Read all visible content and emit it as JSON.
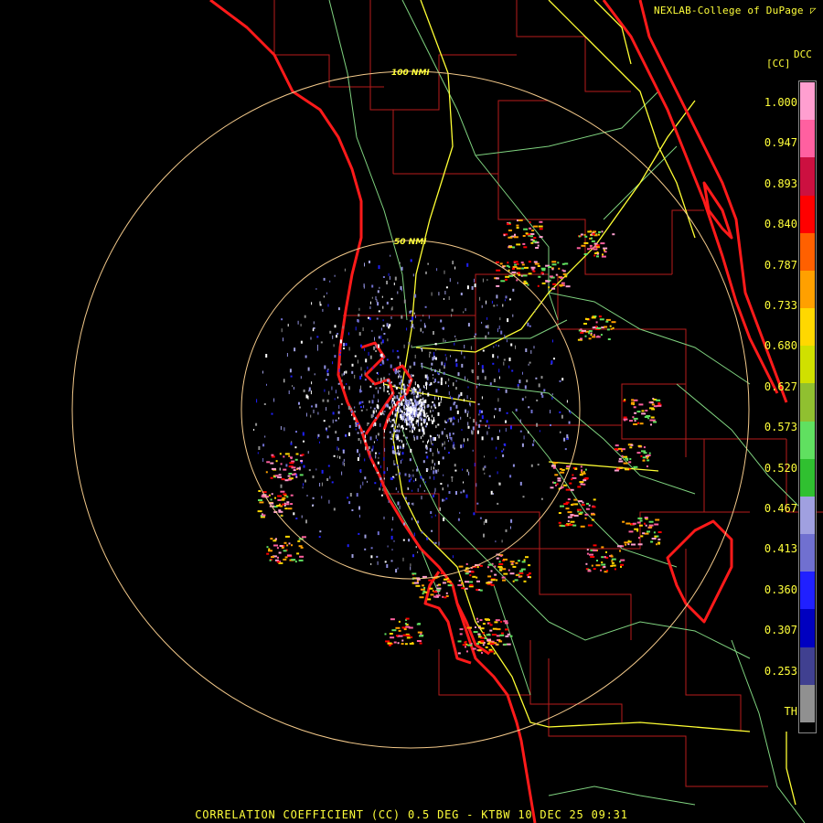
{
  "credit": "NEXLAB-College of DuPage",
  "credit_mark": "◸",
  "legend": {
    "product": "DCC",
    "unit": "[CC]",
    "ticks": [
      "1.000",
      "0.947",
      "0.893",
      "0.840",
      "0.787",
      "0.733",
      "0.680",
      "0.627",
      "0.573",
      "0.520",
      "0.467",
      "0.413",
      "0.360",
      "0.307",
      "0.253",
      "TH"
    ]
  },
  "range_rings": {
    "inner_label": "50 NMI",
    "outer_label": "100 NMI",
    "color": "#f3c98a"
  },
  "caption": "CORRELATION COEFFICIENT (CC) 0.5 DEG - KTBW 10 DEC 25 09:31",
  "colors": {
    "coastline": "#ff1a1a",
    "county_lines": "#b71c1c",
    "highways": "#ffff33",
    "roads": "#7fd27f",
    "text": "#ffff3a"
  },
  "scale_colors": [
    "#ff9fd0",
    "#ff60a0",
    "#cc1040",
    "#ff0000",
    "#ff6000",
    "#ffa000",
    "#ffd800",
    "#d0e000",
    "#90c030",
    "#60e060",
    "#30c030",
    "#a0a0e0",
    "#7070d0",
    "#2020ff",
    "#0000c0",
    "#404090",
    "#909090"
  ]
}
